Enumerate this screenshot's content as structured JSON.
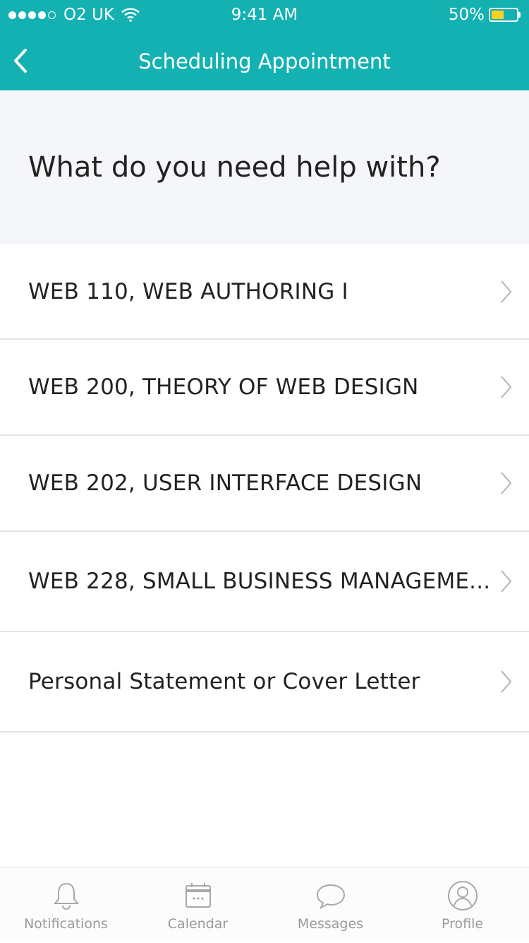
{
  "status_bar": {
    "carrier": "O2 UK",
    "time": "9:41 AM",
    "battery": "50%",
    "battery_level": 0.5,
    "signal_bars_filled": 4,
    "signal_bars_total": 5
  },
  "nav": {
    "title": "Scheduling Appointment",
    "back_icon": "chevron-left-icon"
  },
  "question": "What do you need help with?",
  "options": [
    {
      "label": "WEB 110, WEB AUTHORING I"
    },
    {
      "label": "WEB 200, THEORY OF WEB DESIGN"
    },
    {
      "label": "WEB 202, USER INTERFACE DESIGN"
    },
    {
      "label": "WEB 228, SMALL BUSINESS MANAGEME..."
    },
    {
      "label": "Personal Statement or Cover Letter"
    }
  ],
  "tabs": [
    {
      "label": "Notifications",
      "icon": "bell-icon"
    },
    {
      "label": "Calendar",
      "icon": "calendar-icon"
    },
    {
      "label": "Messages",
      "icon": "chat-bubble-icon"
    },
    {
      "label": "Profile",
      "icon": "user-icon"
    }
  ],
  "colors": {
    "accent": "#14b1b2",
    "question_background": "#f5f6f9",
    "battery_fill": "#f7d21f",
    "tab_inactive": "#9a9a9a"
  }
}
